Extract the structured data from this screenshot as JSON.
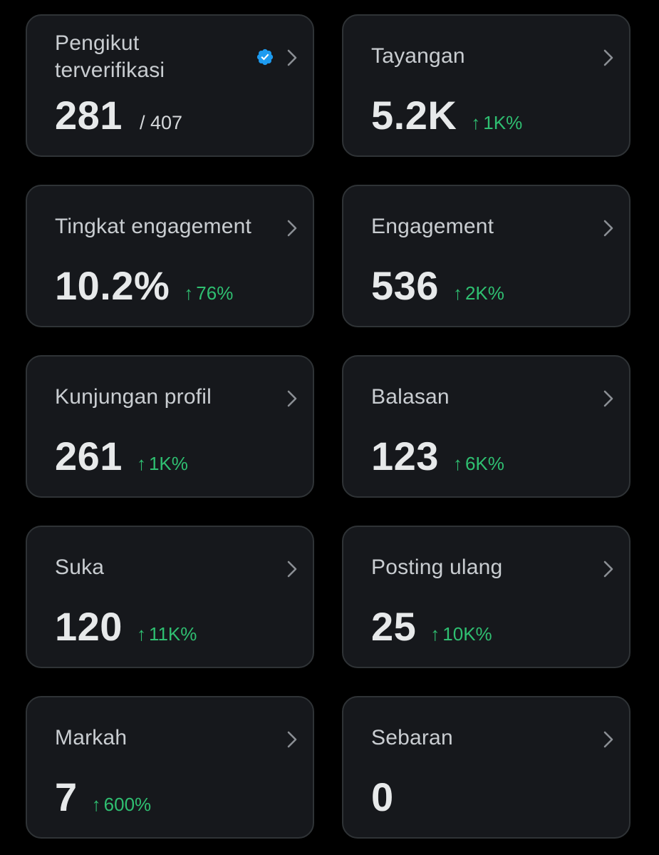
{
  "colors": {
    "background": "#000000",
    "card_background": "#16181c",
    "card_border": "#2f3336",
    "positive_change": "#2fbf71",
    "verified_badge": "#1d9bf0"
  },
  "icons": {
    "chevron": "chevron-right-icon",
    "verified": "verified-badge-icon",
    "change_arrow": "arrow-up-icon"
  },
  "arrow_glyph": "↑",
  "metrics": [
    {
      "id": "verified-followers",
      "label": "Pengikut terverifikasi",
      "value": "281",
      "total": "/ 407",
      "change": null,
      "verified_badge": true
    },
    {
      "id": "impressions",
      "label": "Tayangan",
      "value": "5.2K",
      "total": null,
      "change": "1K%"
    },
    {
      "id": "engagement-rate",
      "label": "Tingkat engagement",
      "value": "10.2%",
      "total": null,
      "change": "76%"
    },
    {
      "id": "engagements",
      "label": "Engagement",
      "value": "536",
      "total": null,
      "change": "2K%"
    },
    {
      "id": "profile-visits",
      "label": "Kunjungan profil",
      "value": "261",
      "total": null,
      "change": "1K%"
    },
    {
      "id": "replies",
      "label": "Balasan",
      "value": "123",
      "total": null,
      "change": "6K%"
    },
    {
      "id": "likes",
      "label": "Suka",
      "value": "120",
      "total": null,
      "change": "11K%"
    },
    {
      "id": "reposts",
      "label": "Posting ulang",
      "value": "25",
      "total": null,
      "change": "10K%"
    },
    {
      "id": "bookmarks",
      "label": "Markah",
      "value": "7",
      "total": null,
      "change": "600%"
    },
    {
      "id": "shares",
      "label": "Sebaran",
      "value": "0",
      "total": null,
      "change": null
    }
  ]
}
